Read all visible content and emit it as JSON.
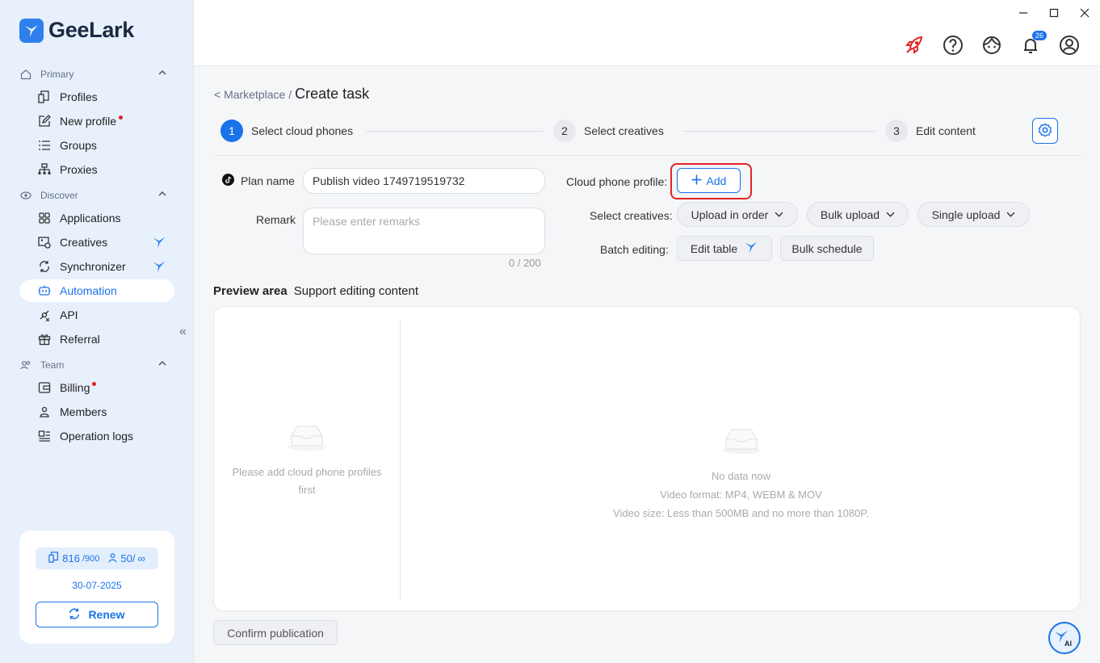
{
  "app": {
    "name": "GeeLark"
  },
  "sidebar": {
    "sections": [
      {
        "label": "Primary"
      },
      {
        "label": "Discover"
      },
      {
        "label": "Team"
      }
    ],
    "items": [
      {
        "label": "Profiles"
      },
      {
        "label": "New profile"
      },
      {
        "label": "Groups"
      },
      {
        "label": "Proxies"
      },
      {
        "label": "Applications"
      },
      {
        "label": "Creatives"
      },
      {
        "label": "Synchronizer"
      },
      {
        "label": "Automation"
      },
      {
        "label": "API"
      },
      {
        "label": "Referral"
      },
      {
        "label": "Billing"
      },
      {
        "label": "Members"
      },
      {
        "label": "Operation logs"
      }
    ],
    "usage": {
      "profiles_used": "816",
      "profiles_total": "/900",
      "members": "50/",
      "members_total": "∞"
    },
    "expiry_date": "30-07-2025",
    "renew_label": "Renew"
  },
  "topbar": {
    "notification_count": "26"
  },
  "breadcrumb": {
    "parent": "< Marketplace /",
    "current": "Create task"
  },
  "steps": [
    {
      "num": "1",
      "label": "Select cloud phones"
    },
    {
      "num": "2",
      "label": "Select creatives"
    },
    {
      "num": "3",
      "label": "Edit content"
    }
  ],
  "form": {
    "plan_name_label": "Plan name",
    "plan_name_value": "Publish video 1749719519732",
    "remark_label": "Remark",
    "remark_placeholder": "Please enter remarks",
    "remark_counter": "0 / 200",
    "cloud_profile_label": "Cloud phone profile:",
    "add_label": "Add",
    "select_creatives_label": "Select creatives:",
    "upload_in_order": "Upload in order",
    "bulk_upload": "Bulk upload",
    "single_upload": "Single upload",
    "batch_editing_label": "Batch editing:",
    "edit_table": "Edit table",
    "bulk_schedule": "Bulk schedule"
  },
  "preview": {
    "title": "Preview area",
    "subtitle": "Support editing content",
    "left_empty": "Please add cloud phone profiles first",
    "no_data": "No data now",
    "video_format": "Video format: MP4, WEBM & MOV",
    "video_size": "Video size: Less than 500MB and no more than 1080P."
  },
  "confirm_label": "Confirm publication",
  "ai_label": "AI",
  "colors": {
    "accent": "#1a73e8",
    "alert": "#e02424",
    "sidebar_bg": "#e7f0fb"
  }
}
